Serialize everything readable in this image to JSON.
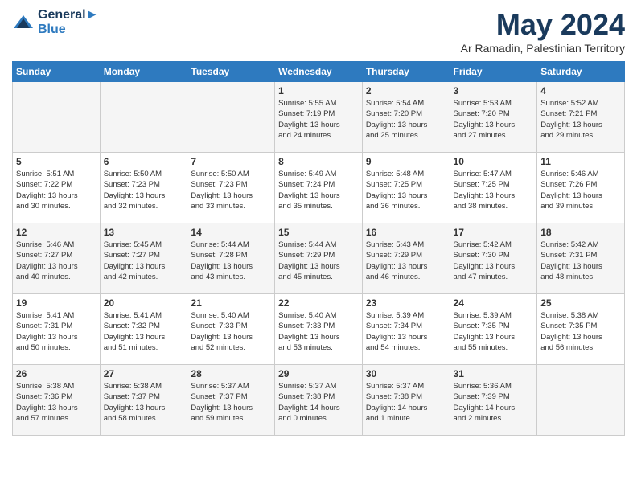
{
  "header": {
    "logo_line1": "General",
    "logo_line2": "Blue",
    "month": "May 2024",
    "location": "Ar Ramadin, Palestinian Territory"
  },
  "days_of_week": [
    "Sunday",
    "Monday",
    "Tuesday",
    "Wednesday",
    "Thursday",
    "Friday",
    "Saturday"
  ],
  "weeks": [
    [
      {
        "day": "",
        "info": ""
      },
      {
        "day": "",
        "info": ""
      },
      {
        "day": "",
        "info": ""
      },
      {
        "day": "1",
        "info": "Sunrise: 5:55 AM\nSunset: 7:19 PM\nDaylight: 13 hours\nand 24 minutes."
      },
      {
        "day": "2",
        "info": "Sunrise: 5:54 AM\nSunset: 7:20 PM\nDaylight: 13 hours\nand 25 minutes."
      },
      {
        "day": "3",
        "info": "Sunrise: 5:53 AM\nSunset: 7:20 PM\nDaylight: 13 hours\nand 27 minutes."
      },
      {
        "day": "4",
        "info": "Sunrise: 5:52 AM\nSunset: 7:21 PM\nDaylight: 13 hours\nand 29 minutes."
      }
    ],
    [
      {
        "day": "5",
        "info": "Sunrise: 5:51 AM\nSunset: 7:22 PM\nDaylight: 13 hours\nand 30 minutes."
      },
      {
        "day": "6",
        "info": "Sunrise: 5:50 AM\nSunset: 7:23 PM\nDaylight: 13 hours\nand 32 minutes."
      },
      {
        "day": "7",
        "info": "Sunrise: 5:50 AM\nSunset: 7:23 PM\nDaylight: 13 hours\nand 33 minutes."
      },
      {
        "day": "8",
        "info": "Sunrise: 5:49 AM\nSunset: 7:24 PM\nDaylight: 13 hours\nand 35 minutes."
      },
      {
        "day": "9",
        "info": "Sunrise: 5:48 AM\nSunset: 7:25 PM\nDaylight: 13 hours\nand 36 minutes."
      },
      {
        "day": "10",
        "info": "Sunrise: 5:47 AM\nSunset: 7:25 PM\nDaylight: 13 hours\nand 38 minutes."
      },
      {
        "day": "11",
        "info": "Sunrise: 5:46 AM\nSunset: 7:26 PM\nDaylight: 13 hours\nand 39 minutes."
      }
    ],
    [
      {
        "day": "12",
        "info": "Sunrise: 5:46 AM\nSunset: 7:27 PM\nDaylight: 13 hours\nand 40 minutes."
      },
      {
        "day": "13",
        "info": "Sunrise: 5:45 AM\nSunset: 7:27 PM\nDaylight: 13 hours\nand 42 minutes."
      },
      {
        "day": "14",
        "info": "Sunrise: 5:44 AM\nSunset: 7:28 PM\nDaylight: 13 hours\nand 43 minutes."
      },
      {
        "day": "15",
        "info": "Sunrise: 5:44 AM\nSunset: 7:29 PM\nDaylight: 13 hours\nand 45 minutes."
      },
      {
        "day": "16",
        "info": "Sunrise: 5:43 AM\nSunset: 7:29 PM\nDaylight: 13 hours\nand 46 minutes."
      },
      {
        "day": "17",
        "info": "Sunrise: 5:42 AM\nSunset: 7:30 PM\nDaylight: 13 hours\nand 47 minutes."
      },
      {
        "day": "18",
        "info": "Sunrise: 5:42 AM\nSunset: 7:31 PM\nDaylight: 13 hours\nand 48 minutes."
      }
    ],
    [
      {
        "day": "19",
        "info": "Sunrise: 5:41 AM\nSunset: 7:31 PM\nDaylight: 13 hours\nand 50 minutes."
      },
      {
        "day": "20",
        "info": "Sunrise: 5:41 AM\nSunset: 7:32 PM\nDaylight: 13 hours\nand 51 minutes."
      },
      {
        "day": "21",
        "info": "Sunrise: 5:40 AM\nSunset: 7:33 PM\nDaylight: 13 hours\nand 52 minutes."
      },
      {
        "day": "22",
        "info": "Sunrise: 5:40 AM\nSunset: 7:33 PM\nDaylight: 13 hours\nand 53 minutes."
      },
      {
        "day": "23",
        "info": "Sunrise: 5:39 AM\nSunset: 7:34 PM\nDaylight: 13 hours\nand 54 minutes."
      },
      {
        "day": "24",
        "info": "Sunrise: 5:39 AM\nSunset: 7:35 PM\nDaylight: 13 hours\nand 55 minutes."
      },
      {
        "day": "25",
        "info": "Sunrise: 5:38 AM\nSunset: 7:35 PM\nDaylight: 13 hours\nand 56 minutes."
      }
    ],
    [
      {
        "day": "26",
        "info": "Sunrise: 5:38 AM\nSunset: 7:36 PM\nDaylight: 13 hours\nand 57 minutes."
      },
      {
        "day": "27",
        "info": "Sunrise: 5:38 AM\nSunset: 7:37 PM\nDaylight: 13 hours\nand 58 minutes."
      },
      {
        "day": "28",
        "info": "Sunrise: 5:37 AM\nSunset: 7:37 PM\nDaylight: 13 hours\nand 59 minutes."
      },
      {
        "day": "29",
        "info": "Sunrise: 5:37 AM\nSunset: 7:38 PM\nDaylight: 14 hours\nand 0 minutes."
      },
      {
        "day": "30",
        "info": "Sunrise: 5:37 AM\nSunset: 7:38 PM\nDaylight: 14 hours\nand 1 minute."
      },
      {
        "day": "31",
        "info": "Sunrise: 5:36 AM\nSunset: 7:39 PM\nDaylight: 14 hours\nand 2 minutes."
      },
      {
        "day": "",
        "info": ""
      }
    ]
  ]
}
